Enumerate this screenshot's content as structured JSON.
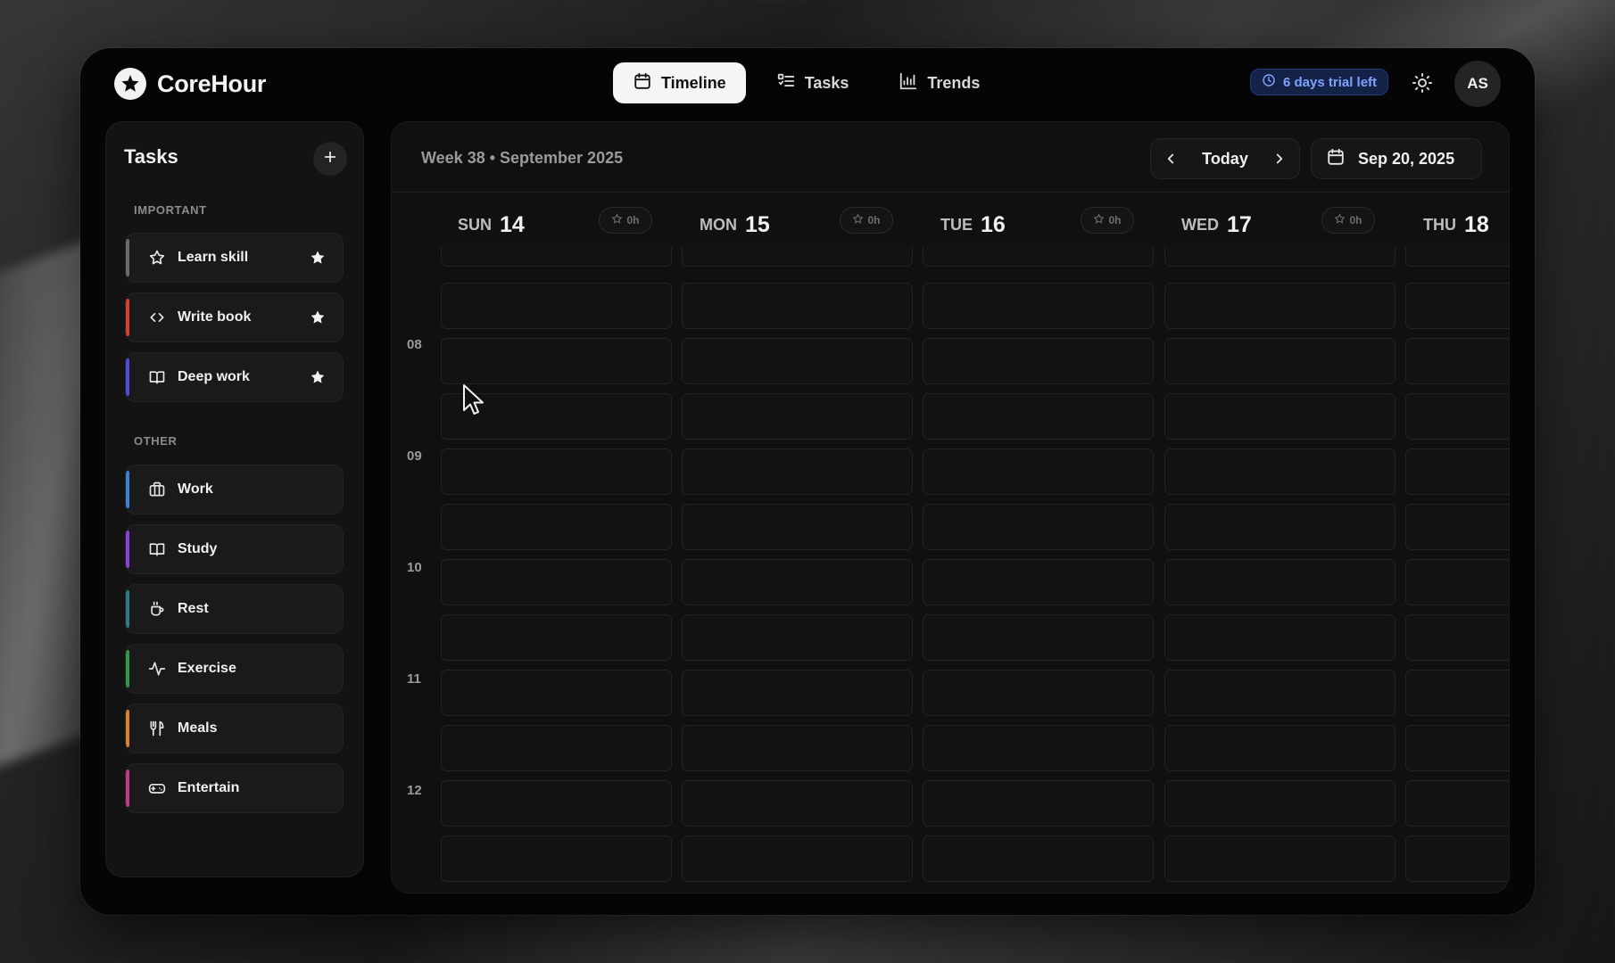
{
  "app": {
    "name": "CoreHour",
    "logo_icon": "star-badge-icon"
  },
  "nav": {
    "tabs": [
      {
        "label": "Timeline",
        "icon": "calendar-icon",
        "active": true
      },
      {
        "label": "Tasks",
        "icon": "list-checks-icon",
        "active": false
      },
      {
        "label": "Trends",
        "icon": "bar-chart-icon",
        "active": false
      }
    ]
  },
  "header": {
    "trial_text": "6 days trial left",
    "trial_icon": "clock-icon",
    "theme_icon": "sun-icon",
    "avatar_initials": "AS"
  },
  "sidebar": {
    "title": "Tasks",
    "add_icon": "plus-icon",
    "important_label": "IMPORTANT",
    "other_label": "OTHER",
    "important": [
      {
        "label": "Learn skill",
        "icon": "star-outline-icon",
        "color": "#6b6b6b",
        "starred": true
      },
      {
        "label": "Write book",
        "icon": "code-icon",
        "color": "#d9412b",
        "starred": true
      },
      {
        "label": "Deep work",
        "icon": "book-open-icon",
        "color": "#4a4fe0",
        "starred": true
      }
    ],
    "other": [
      {
        "label": "Work",
        "icon": "briefcase-icon",
        "color": "#3b82d6"
      },
      {
        "label": "Study",
        "icon": "book-open-icon",
        "color": "#8b3fe0"
      },
      {
        "label": "Rest",
        "icon": "coffee-icon",
        "color": "#2a7a8a"
      },
      {
        "label": "Exercise",
        "icon": "activity-icon",
        "color": "#2f9a4a"
      },
      {
        "label": "Meals",
        "icon": "utensils-icon",
        "color": "#d9822b"
      },
      {
        "label": "Entertain",
        "icon": "gamepad-icon",
        "color": "#c23a8a"
      }
    ]
  },
  "calendar": {
    "week_title": "Week 38 • September 2025",
    "today_label": "Today",
    "date_label": "Sep 20, 2025",
    "days": [
      {
        "dow": "SUN",
        "num": "14",
        "hours": "0h"
      },
      {
        "dow": "MON",
        "num": "15",
        "hours": "0h"
      },
      {
        "dow": "TUE",
        "num": "16",
        "hours": "0h"
      },
      {
        "dow": "WED",
        "num": "17",
        "hours": "0h"
      },
      {
        "dow": "THU",
        "num": "18",
        "hours": ""
      }
    ],
    "hours": [
      "08",
      "09",
      "10",
      "11",
      "12"
    ]
  }
}
